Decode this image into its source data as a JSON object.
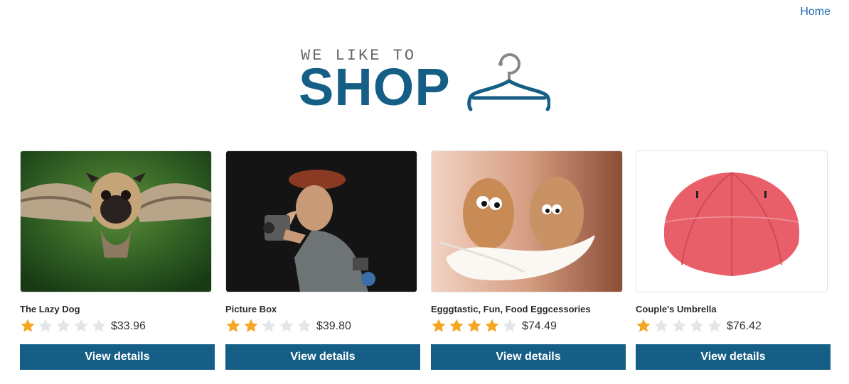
{
  "nav": {
    "home_label": "Home"
  },
  "logo": {
    "small_text": "WE LIKE TO",
    "big_text": "SHOP",
    "icon": "hanger-icon"
  },
  "colors": {
    "brand": "#155e85",
    "link": "#1f6db3",
    "star_on": "#f5a623",
    "star_off": "#e2e6e9"
  },
  "products": [
    {
      "title": "The Lazy Dog",
      "rating": 1,
      "max_rating": 5,
      "price": "$33.96",
      "button_label": "View details",
      "image": "flying-pug-photo"
    },
    {
      "title": "Picture Box",
      "rating": 2,
      "max_rating": 5,
      "price": "$39.80",
      "button_label": "View details",
      "image": "photographer-figurine-photo"
    },
    {
      "title": "Egggtastic, Fun, Food Eggcessories",
      "rating": 4,
      "max_rating": 5,
      "price": "$74.49",
      "button_label": "View details",
      "image": "eggs-with-eyes-photo"
    },
    {
      "title": "Couple's Umbrella",
      "rating": 1,
      "max_rating": 5,
      "price": "$76.42",
      "button_label": "View details",
      "image": "red-umbrella-photo"
    }
  ]
}
